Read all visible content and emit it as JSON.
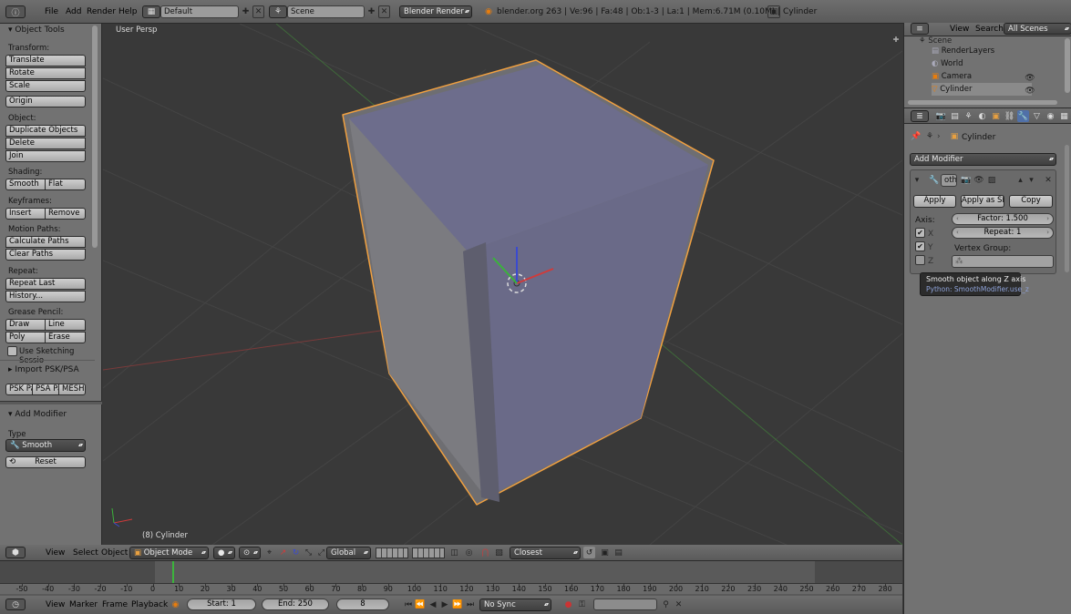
{
  "topbar": {
    "menus": [
      "File",
      "Add",
      "Render",
      "Help"
    ],
    "layout": "Default",
    "scene": "Scene",
    "engine": "Blender Render",
    "info": "blender.org 263 | Ve:96 | Fa:48 | Ob:1-3 | La:1 | Mem:6.71M (0.10M) | Cylinder"
  },
  "toolshelf": {
    "title": "Object Tools",
    "transform_label": "Transform:",
    "translate": "Translate",
    "rotate": "Rotate",
    "scale": "Scale",
    "origin": "Origin",
    "object_label": "Object:",
    "duplicate": "Duplicate Objects",
    "delete": "Delete",
    "join": "Join",
    "shading_label": "Shading:",
    "smooth": "Smooth",
    "flat": "Flat",
    "keyframes_label": "Keyframes:",
    "insert": "Insert",
    "remove": "Remove",
    "motion_label": "Motion Paths:",
    "calc_paths": "Calculate Paths",
    "clear_paths": "Clear Paths",
    "repeat_label": "Repeat:",
    "repeat_last": "Repeat Last",
    "history": "History...",
    "grease_label": "Grease Pencil:",
    "draw": "Draw",
    "line": "Line",
    "poly": "Poly",
    "erase": "Erase",
    "sketching": "Use Sketching Sessio",
    "import_title": "Import PSK/PSA",
    "psk": "PSK Pa",
    "psa": "PSA Pa",
    "meshb": "MESH B"
  },
  "operator_panel": {
    "title": "Add Modifier",
    "type_label": "Type",
    "type_value": "Smooth",
    "reset": "Reset"
  },
  "viewport": {
    "view_name": "User Persp",
    "object_label": "(8) Cylinder"
  },
  "view3d_header": {
    "menus": [
      "View",
      "Select",
      "Object"
    ],
    "mode": "Object Mode",
    "orientation": "Global",
    "snap": "Closest"
  },
  "timeline": {
    "ticks": [
      "-50",
      "-40",
      "-30",
      "-20",
      "-10",
      "0",
      "10",
      "20",
      "30",
      "40",
      "50",
      "60",
      "70",
      "80",
      "90",
      "100",
      "110",
      "120",
      "130",
      "140",
      "150",
      "160",
      "170",
      "180",
      "190",
      "200",
      "210",
      "220",
      "230",
      "240",
      "250",
      "260",
      "270",
      "280"
    ],
    "current_frame_value": 8,
    "menus": [
      "View",
      "Marker",
      "Frame",
      "Playback"
    ],
    "start": "Start: 1",
    "end": "End: 250",
    "current": "8",
    "sync": "No Sync"
  },
  "outliner": {
    "menus": [
      "View",
      "Search"
    ],
    "filter": "All Scenes",
    "items": [
      "Scene",
      "RenderLayers",
      "World",
      "Camera",
      "Cylinder"
    ]
  },
  "properties": {
    "breadcrumb": "Cylinder",
    "add_modifier": "Add Modifier",
    "modifier_name": "oth",
    "apply": "Apply",
    "apply_shape": "Apply as Sha",
    "copy": "Copy",
    "axis_label": "Axis:",
    "x": "X",
    "y": "Y",
    "z": "Z",
    "factor": "Factor: 1.500",
    "repeat": "Repeat: 1",
    "vertex_group_label": "Vertex Group:",
    "tooltip_title": "Smooth object along Z axis",
    "tooltip_python": "Python: SmoothModifier.use_z"
  },
  "colors": {
    "selection_outline": "#f0a040",
    "mesh_inner": "#6e6e8e",
    "viewport_bg": "#393939"
  }
}
